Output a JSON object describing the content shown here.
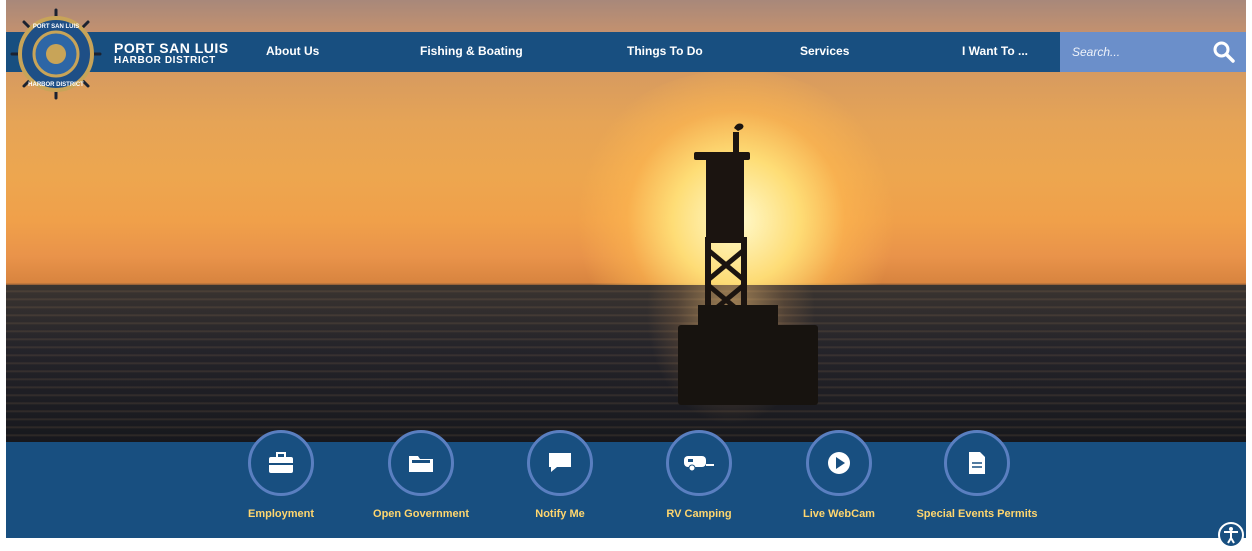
{
  "brand": {
    "line1": "PORT SAN LUIS",
    "line2": "HARBOR DISTRICT"
  },
  "logo_text": {
    "top": "PORT SAN LUIS",
    "bottom": "HARBOR DISTRICT"
  },
  "nav": {
    "items": [
      {
        "label": "About Us"
      },
      {
        "label": "Fishing & Boating"
      },
      {
        "label": "Things To Do"
      },
      {
        "label": "Services"
      },
      {
        "label": "I Want To ..."
      }
    ]
  },
  "search": {
    "placeholder": "Search...",
    "icon": "search-icon"
  },
  "quick_links": [
    {
      "label": "Employment",
      "icon": "briefcase-icon"
    },
    {
      "label": "Open Government",
      "icon": "folder-icon"
    },
    {
      "label": "Notify Me",
      "icon": "chat-bubble-icon"
    },
    {
      "label": "RV Camping",
      "icon": "rv-trailer-icon"
    },
    {
      "label": "Live WebCam",
      "icon": "play-icon"
    },
    {
      "label": "Special Events Permits",
      "icon": "document-icon"
    }
  ],
  "colors": {
    "nav_bg": "#184f80",
    "search_bg": "#6b8fca",
    "quick_link_label": "#ffd66e",
    "circle_border": "#5a7fc0"
  },
  "accessibility": {
    "icon": "accessibility-icon"
  }
}
